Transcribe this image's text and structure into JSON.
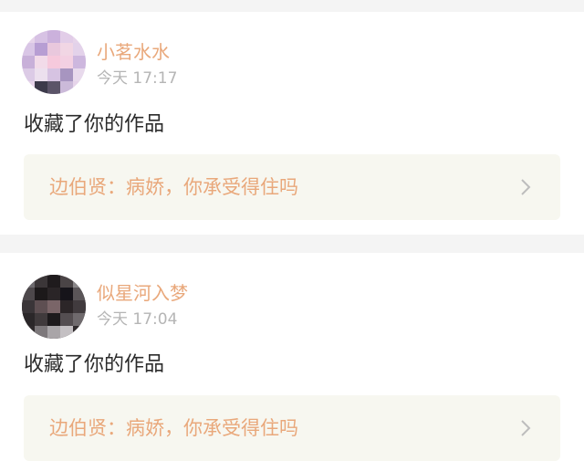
{
  "colors": {
    "accent": "#e9a87b",
    "chevron": "#bdbdbd"
  },
  "notifications": [
    {
      "username": "小茗水水",
      "time": "今天 17:17",
      "action": "收藏了你的作品",
      "work_title": "边伯贤：病娇，你承受得住吗",
      "avatar_icon": "avatar-pixelated-lavender",
      "chevron_icon": "chevron-right-icon"
    },
    {
      "username": "似星河入梦",
      "time": "今天 17:04",
      "action": "收藏了你的作品",
      "work_title": "边伯贤：病娇，你承受得住吗",
      "avatar_icon": "avatar-pixelated-dark",
      "chevron_icon": "chevron-right-icon"
    }
  ]
}
